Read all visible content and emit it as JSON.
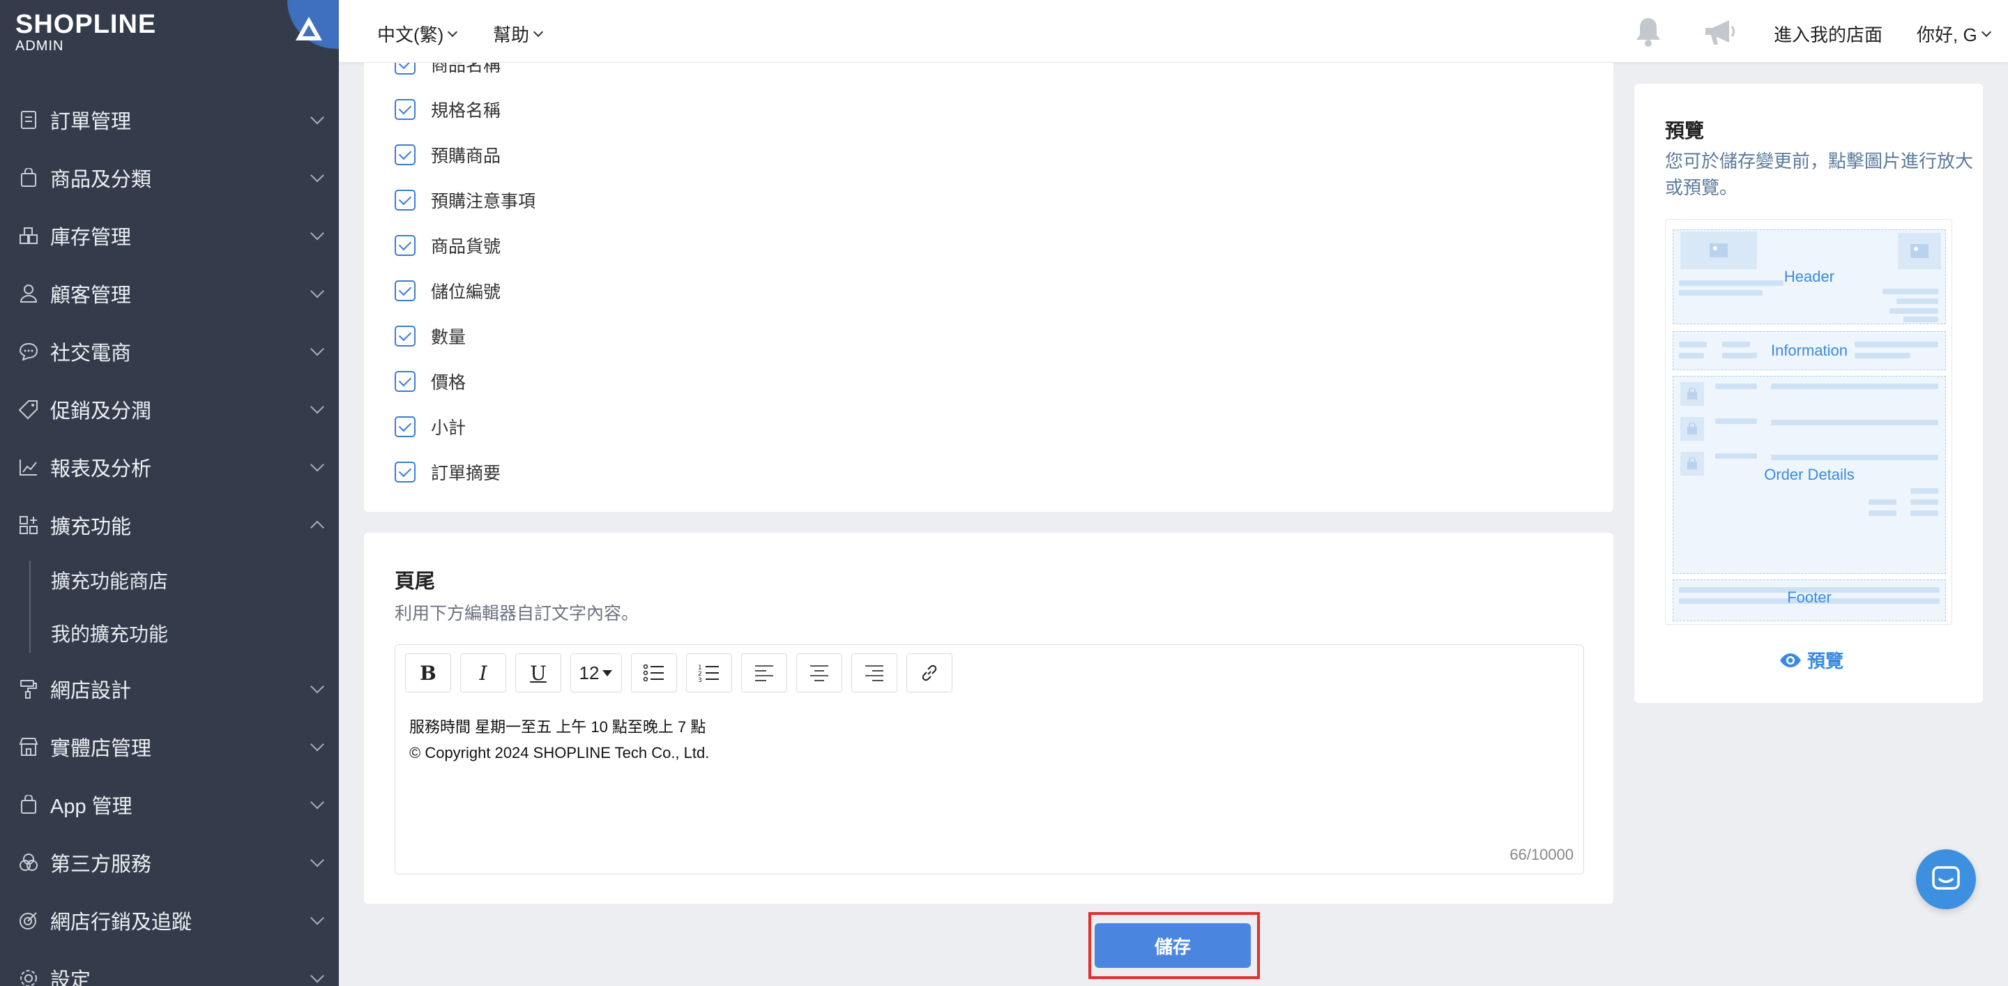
{
  "brand": {
    "name": "SHOPLINE",
    "sub": "ADMIN"
  },
  "topbar": {
    "language": "中文(繁)",
    "help": "幫助",
    "store_link": "進入我的店面",
    "greeting": "你好, G"
  },
  "sidebar": {
    "items": [
      {
        "label": "訂單管理",
        "icon": "order-icon"
      },
      {
        "label": "商品及分類",
        "icon": "bag-icon"
      },
      {
        "label": "庫存管理",
        "icon": "inventory-icon"
      },
      {
        "label": "顧客管理",
        "icon": "customer-icon"
      },
      {
        "label": "社交電商",
        "icon": "chat-bubble-icon"
      },
      {
        "label": "促銷及分潤",
        "icon": "tag-icon"
      },
      {
        "label": "報表及分析",
        "icon": "chart-icon"
      },
      {
        "label": "擴充功能",
        "icon": "apps-icon"
      }
    ],
    "sub_items": [
      "擴充功能商店",
      "我的擴充功能"
    ],
    "items_after": [
      {
        "label": "網店設計",
        "icon": "paint-roller-icon"
      },
      {
        "label": "實體店管理",
        "icon": "store-icon"
      },
      {
        "label": "App 管理",
        "icon": "app-bag-icon"
      },
      {
        "label": "第三方服務",
        "icon": "circles-icon"
      },
      {
        "label": "網店行銷及追蹤",
        "icon": "target-icon"
      },
      {
        "label": "設定",
        "icon": "gear-icon"
      }
    ]
  },
  "fields": {
    "partial_top": "商品名稱",
    "items": [
      "規格名稱",
      "預購商品",
      "預購注意事項",
      "商品貨號",
      "儲位編號",
      "數量",
      "價格",
      "小計",
      "訂單摘要"
    ]
  },
  "footer_section": {
    "title": "頁尾",
    "description": "利用下方編輯器自訂文字內容。",
    "font_size": "12",
    "line1": "服務時間 星期一至五 上午 10 點至晚上 7 點",
    "line2": "© Copyright 2024 SHOPLINE Tech Co., Ltd.",
    "counter": "66/10000"
  },
  "save_label": "儲存",
  "preview": {
    "title": "預覽",
    "description": "您可於儲存變更前，點擊圖片進行放大或預覽。",
    "zones": {
      "header": "Header",
      "information": "Information",
      "order_details": "Order Details",
      "footer": "Footer"
    },
    "link": "預覽"
  }
}
